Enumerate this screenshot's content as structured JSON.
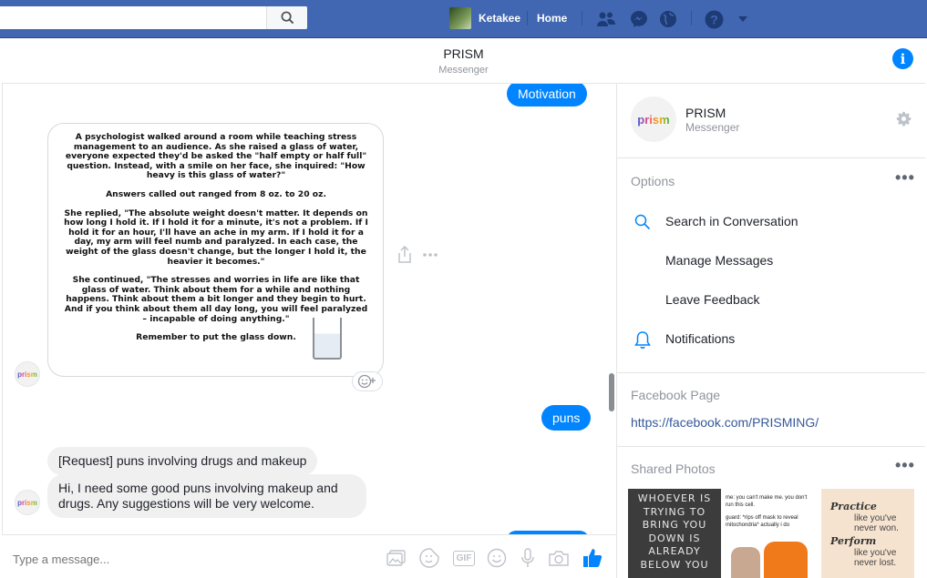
{
  "topbar": {
    "user_name": "Ketakee",
    "home_label": "Home",
    "icons": [
      "search-icon",
      "friend-requests-icon",
      "messenger-icon",
      "notifications-globe-icon",
      "help-icon",
      "account-menu-chevron-icon"
    ],
    "colors": {
      "bar": "#4267b2",
      "accent": "#0084ff"
    }
  },
  "conversation": {
    "title": "PRISM",
    "subtitle": "Messenger"
  },
  "messages": {
    "motivation": "Motivation",
    "image_text": [
      "A psychologist walked around a room while teaching stress management to an audience. As she raised a glass of water, everyone expected they'd be asked the \"half empty or half full\" question. Instead, with a smile on her face, she inquired: \"How heavy is this glass of water?\"",
      "Answers called out ranged from 8 oz. to 20 oz.",
      "She replied, \"The absolute weight doesn't matter. It depends on how long I hold it. If I hold it for a minute, it's not a problem. If I hold it for an hour, I'll have an ache in my arm. If I hold it for a day, my arm will feel numb and paralyzed. In each case, the weight of the glass doesn't change, but the longer I hold it, the heavier it becomes.\"",
      "She continued, \"The stresses and worries in life are like that glass of water. Think about them for a while and nothing happens. Think about them a bit longer and they begin to hurt. And if you think about them all day long, you will feel paralyzed – incapable of doing anything.\"",
      "Remember to put the glass down."
    ],
    "puns": "puns",
    "request": "[Request] puns involving drugs and makeup",
    "request_body": "Hi, I need some good puns involving makeup and drugs. Any suggestions will be very welcome.",
    "avatar_text": "prism"
  },
  "composer": {
    "placeholder": "Type a message...",
    "gif_label": "GIF"
  },
  "sidebar": {
    "name": "PRISM",
    "subtitle": "Messenger",
    "logo_text": "prism",
    "options_label": "Options",
    "options": [
      {
        "label": "Search in Conversation",
        "icon": "search-icon"
      },
      {
        "label": "Manage Messages"
      },
      {
        "label": "Leave Feedback"
      },
      {
        "label": "Notifications",
        "icon": "bell-icon"
      }
    ],
    "fb_page_label": "Facebook Page",
    "fb_page_url": "https://facebook.com/PRISMING/",
    "shared_photos_label": "Shared Photos",
    "photos": {
      "p1": "WHOEVER IS TRYING TO BRING YOU DOWN IS ALREADY BELOW YOU",
      "p2_top": "me: you can't make me. you don't run this cell.",
      "p2_mid": "guard: *rips off mask to reveal mitochondria* actually i do",
      "p3": [
        "Practice",
        "like you've never won.",
        "Perform",
        "like you've never lost."
      ]
    }
  }
}
